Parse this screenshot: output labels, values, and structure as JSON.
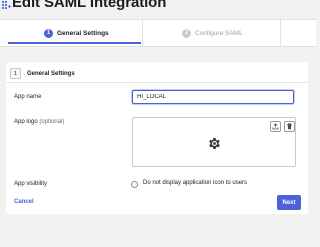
{
  "header": {
    "title": "Edit SAML Integration",
    "icon": "app-grid-plus-icon"
  },
  "stepper": {
    "steps": [
      {
        "number": "1",
        "label": "General Settings",
        "state": "active"
      },
      {
        "number": "2",
        "label": "Configure SAML",
        "state": "inactive"
      }
    ]
  },
  "section": {
    "number": "1",
    "title": "General Settings"
  },
  "form": {
    "app_name": {
      "label": "App name",
      "value": "HI_LOCAL"
    },
    "app_logo": {
      "label": "App logo",
      "optional": "(optional)",
      "upload_icon": "upload-icon",
      "delete_icon": "trash-icon",
      "placeholder_icon": "gear-icon"
    },
    "app_visibility": {
      "label": "App visibility",
      "option_label": "Do not display application icon to users",
      "checked": false
    }
  },
  "footer": {
    "cancel_label": "Cancel",
    "next_label": "Next"
  },
  "colors": {
    "accent": "#4b63d6",
    "page_background": "#f2f2f3",
    "card_background": "#ffffff"
  }
}
